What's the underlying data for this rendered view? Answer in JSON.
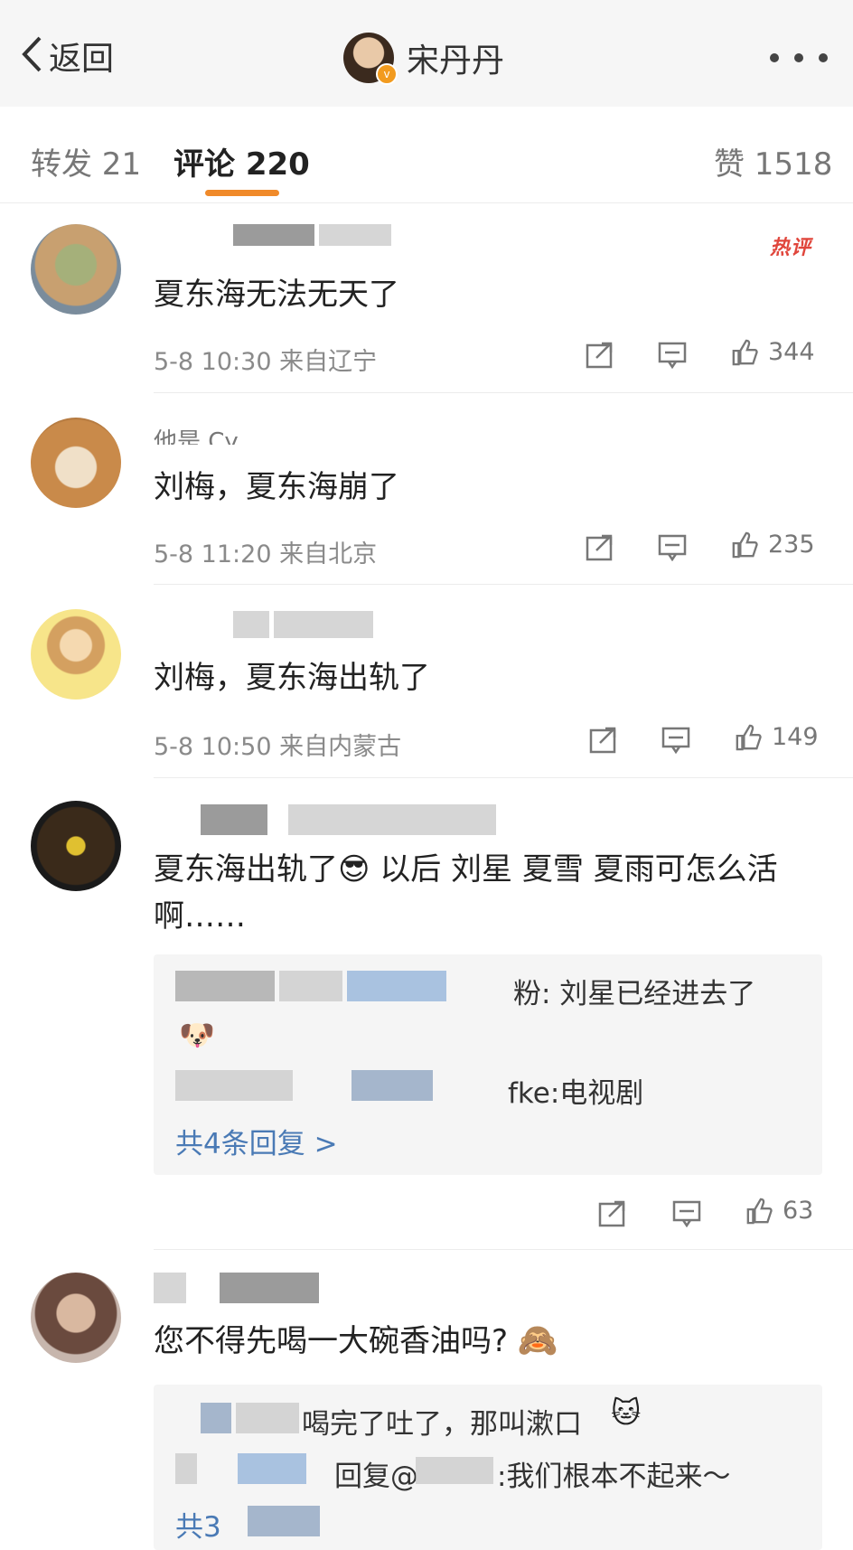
{
  "header": {
    "back_label": "返回",
    "title": "宋丹丹"
  },
  "tabs": {
    "repost": "转发 21",
    "comments": "评论 220",
    "likes": "赞 1518"
  },
  "comments": [
    {
      "badge": "热评",
      "text": "夏东海无法无天了",
      "meta": "5-8 10:30 来自辽宁",
      "likes": "344"
    },
    {
      "username_partial": "他是 Cy",
      "text": "刘梅，夏东海崩了",
      "meta": "5-8 11:20 来自北京",
      "likes": "235"
    },
    {
      "text": "刘梅，夏东海出轨了",
      "meta": "5-8 10:50 来自内蒙古",
      "likes": "149"
    },
    {
      "text": "夏东海出轨了😎 以后 刘星 夏雪 夏雨可怎么活啊……",
      "replies": [
        "粉: 刘星已经进去了",
        "fke:电视剧"
      ],
      "more_replies": "共4条回复 >",
      "likes": "63"
    },
    {
      "text": "您不得先喝一大碗香油吗?",
      "replies": [
        "喝完了吐了，那叫漱口",
        "回复@",
        ":我们根本不起来～"
      ],
      "more_replies": "共3"
    }
  ],
  "colors": {
    "accent": "#f08a2a",
    "link": "#4a7ab5",
    "hot": "#e0463c"
  }
}
